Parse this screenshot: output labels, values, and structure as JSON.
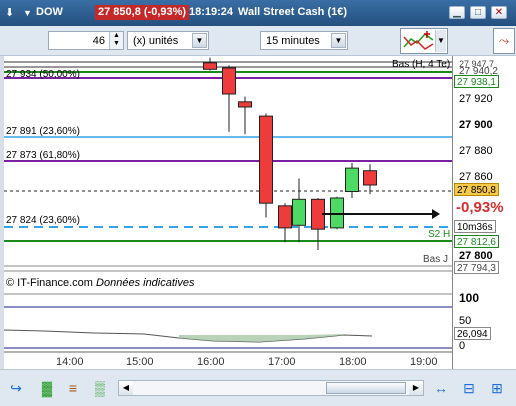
{
  "titlebar": {
    "menu_icon": "down-arrow-icon",
    "instrument": "DOW",
    "price_change": "27 850,8 (-0,93%)",
    "time": "18:19:24",
    "name": "Wall Street Cash (1€)",
    "buttons": [
      "minimize",
      "maximize",
      "close"
    ]
  },
  "toolbar": {
    "quantity": "46",
    "units_label": "(x) unités",
    "interval": "15 minutes"
  },
  "chart": {
    "levels_left": [
      {
        "label": "27 934 (50,00%)",
        "color": "#1a8a1a"
      },
      {
        "label": "27 891 (23,60%)",
        "color": "#33a4e8"
      },
      {
        "label": "27 873 (61,80%)",
        "color": "#7b1fa2"
      },
      {
        "label": "27 824 (23,60%)",
        "color": "#33a4e8"
      }
    ],
    "levels_right": {
      "bas_h": "Bas (H, 4 Te)",
      "s2h": "S2 H",
      "bas_j": "Bas J"
    },
    "axis": {
      "ticks": [
        "27 920",
        "27 900",
        "27 880",
        "27 860",
        "27 800"
      ],
      "tick_top_1": "27 947,7",
      "tick_top_2": "27 940,2",
      "box_938": "27 938,1",
      "current_price": "27 850,8",
      "change": "-0,93%",
      "countdown": "10m36s",
      "box_812": "27 812,6",
      "box_794": "27 794,3"
    },
    "source_note": "© IT-Finance.com",
    "source_note_italic": "Données indicatives",
    "indicator": {
      "level_100": "100",
      "level_50": "50",
      "level_0": "0",
      "value": "26,094"
    },
    "times": [
      "14:00",
      "15:00",
      "16:00",
      "17:00",
      "18:00",
      "19:00"
    ]
  },
  "chart_data": {
    "type": "candlestick",
    "time_axis": [
      "14:00",
      "15:00",
      "16:00",
      "17:00",
      "18:00",
      "19:00"
    ],
    "candles": [
      {
        "o": 27944,
        "h": 27948,
        "l": 27938,
        "c": 27939,
        "dir": "down"
      },
      {
        "o": 27940,
        "h": 27942,
        "l": 27891,
        "c": 27920,
        "dir": "down"
      },
      {
        "o": 27914,
        "h": 27918,
        "l": 27889,
        "c": 27910,
        "dir": "down"
      },
      {
        "o": 27903,
        "h": 27905,
        "l": 27825,
        "c": 27836,
        "dir": "down"
      },
      {
        "o": 27834,
        "h": 27836,
        "l": 27806,
        "c": 27817,
        "dir": "down"
      },
      {
        "o": 27819,
        "h": 27855,
        "l": 27806,
        "c": 27839,
        "dir": "up"
      },
      {
        "o": 27839,
        "h": 27840,
        "l": 27800,
        "c": 27816,
        "dir": "down"
      },
      {
        "o": 27817,
        "h": 27841,
        "l": 27816,
        "c": 27840,
        "dir": "up"
      },
      {
        "o": 27845,
        "h": 27867,
        "l": 27840,
        "c": 27863,
        "dir": "up"
      },
      {
        "o": 27861,
        "h": 27866,
        "l": 27843,
        "c": 27850,
        "dir": "down"
      }
    ],
    "up_color": "#4cd964",
    "down_color": "#ee3b3b"
  }
}
